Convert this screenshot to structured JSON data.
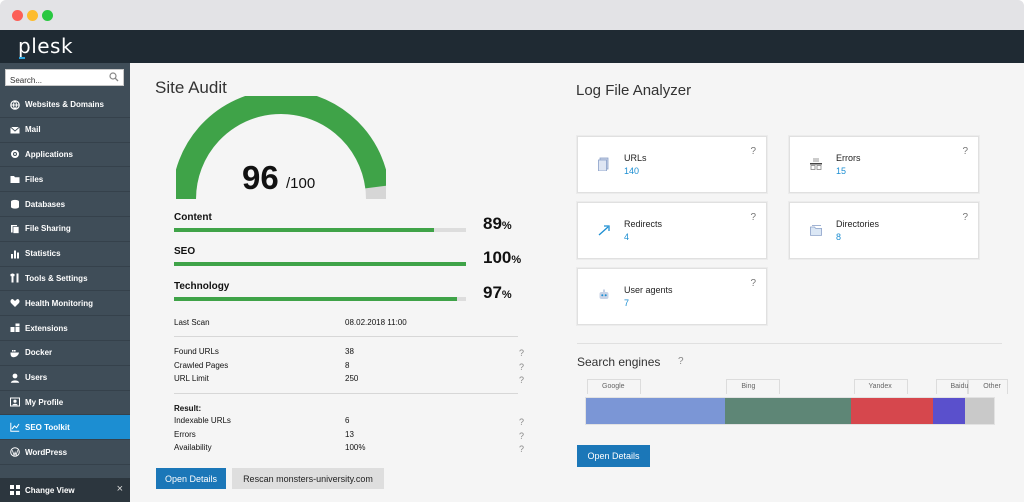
{
  "app": {
    "logo": "plesk"
  },
  "sidebar": {
    "search_placeholder": "Search...",
    "items": [
      {
        "label": "Websites & Domains",
        "icon": "globe-icon"
      },
      {
        "label": "Mail",
        "icon": "mail-icon"
      },
      {
        "label": "Applications",
        "icon": "gear-icon"
      },
      {
        "label": "Files",
        "icon": "folder-icon"
      },
      {
        "label": "Databases",
        "icon": "database-icon"
      },
      {
        "label": "File Sharing",
        "icon": "file-sharing-icon"
      },
      {
        "label": "Statistics",
        "icon": "bar-chart-icon"
      },
      {
        "label": "Tools & Settings",
        "icon": "tools-icon"
      },
      {
        "label": "Health Monitoring",
        "icon": "heart-icon"
      },
      {
        "label": "Extensions",
        "icon": "puzzle-icon"
      },
      {
        "label": "Docker",
        "icon": "docker-icon"
      },
      {
        "label": "Users",
        "icon": "user-icon"
      },
      {
        "label": "My Profile",
        "icon": "profile-icon"
      },
      {
        "label": "SEO Toolkit",
        "icon": "seo-chart-icon",
        "active": true
      },
      {
        "label": "WordPress",
        "icon": "wordpress-icon"
      }
    ],
    "change_view": "Change View"
  },
  "site_audit": {
    "title": "Site Audit",
    "score": "96",
    "score_max": "/100",
    "score_fraction": 0.96,
    "metrics": [
      {
        "name": "Content",
        "pct": "89",
        "fraction": 0.89
      },
      {
        "name": "SEO",
        "pct": "100",
        "fraction": 1.0
      },
      {
        "name": "Technology",
        "pct": "97",
        "fraction": 0.97
      }
    ],
    "pct_sign": "%",
    "last_scan_label": "Last Scan",
    "last_scan_value": "08.02.2018 11:00",
    "stats": [
      {
        "label": "Found URLs",
        "value": "38"
      },
      {
        "label": "Crawled Pages",
        "value": "8"
      },
      {
        "label": "URL Limit",
        "value": "250"
      }
    ],
    "result_label": "Result:",
    "results": [
      {
        "label": "Indexable URLs",
        "value": "6"
      },
      {
        "label": "Errors",
        "value": "13"
      },
      {
        "label": "Availability",
        "value": "100%"
      }
    ],
    "help": "?",
    "open_details": "Open Details",
    "rescan": "Rescan monsters-university.com"
  },
  "log_analyzer": {
    "title": "Log File Analyzer",
    "cards": [
      {
        "title": "URLs",
        "value": "140",
        "icon": "document-icon"
      },
      {
        "title": "Errors",
        "value": "15",
        "icon": "error-robot-icon"
      },
      {
        "title": "Redirects",
        "value": "4",
        "icon": "redirect-arrow-icon"
      },
      {
        "title": "Directories",
        "value": "8",
        "icon": "directory-icon"
      },
      {
        "title": "User agents",
        "value": "7",
        "icon": "robot-icon"
      }
    ],
    "help": "?"
  },
  "search_engines": {
    "title": "Search engines",
    "help": "?",
    "segments": [
      {
        "name": "Google",
        "share": 0.34,
        "color": "#7b96d6"
      },
      {
        "name": "Bing",
        "share": 0.31,
        "color": "#5e8676"
      },
      {
        "name": "Yandex",
        "share": 0.2,
        "color": "#d6474d"
      },
      {
        "name": "Baidu",
        "share": 0.08,
        "color": "#5a50cc"
      },
      {
        "name": "Other",
        "share": 0.07,
        "color": "#c9c9c9"
      }
    ],
    "open_details": "Open Details"
  },
  "colors": {
    "accent": "#1c8ed2",
    "green": "#3fa348",
    "sidebar": "#3f4d58",
    "topbar": "#1f2a33"
  }
}
